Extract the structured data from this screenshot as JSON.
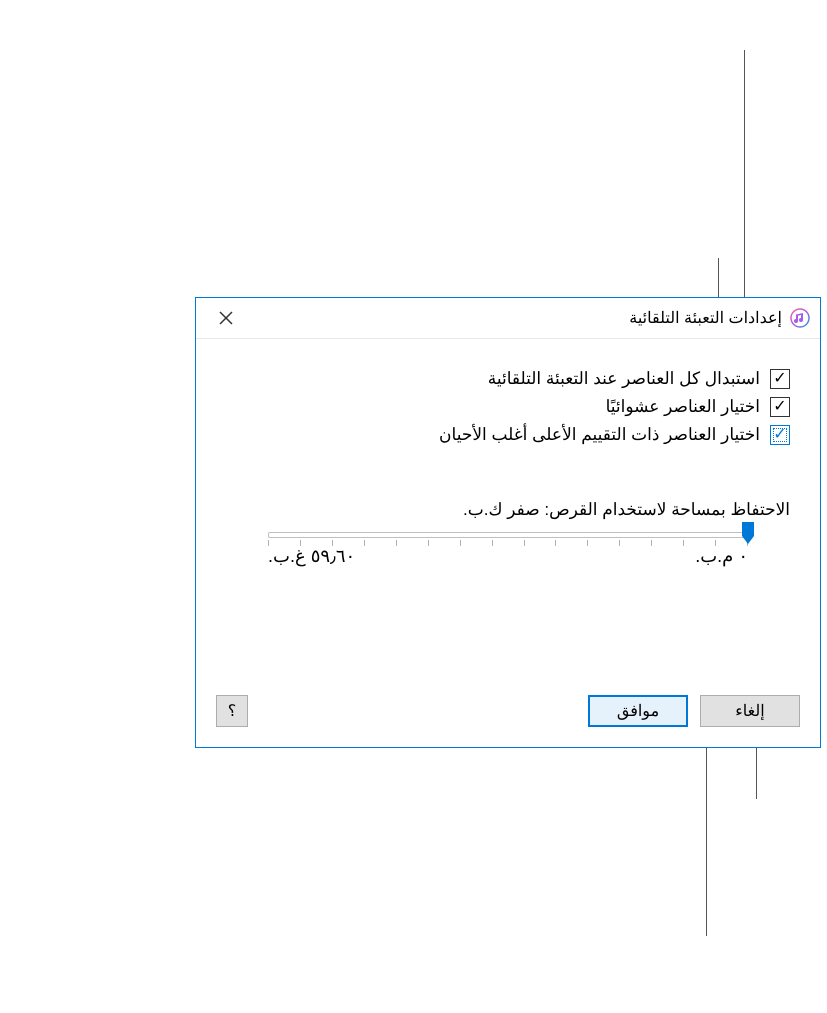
{
  "dialog": {
    "title": "إعدادات التعبئة التلقائية",
    "checkboxes": [
      {
        "label": "استبدال كل العناصر عند التعبئة التلقائية",
        "checked": true
      },
      {
        "label": "اختيار العناصر عشوائيًا",
        "checked": true
      },
      {
        "label": "اختيار العناصر ذات التقييم الأعلى أغلب الأحيان",
        "checked": true
      }
    ],
    "slider": {
      "label": "الاحتفاظ بمساحة لاستخدام القرص: صفر ك.ب.",
      "min_label": "٠ م.ب.",
      "max_label": "٥٩٫٦٠ غ.ب."
    },
    "buttons": {
      "ok": "موافق",
      "cancel": "إلغاء",
      "help": "؟"
    }
  }
}
